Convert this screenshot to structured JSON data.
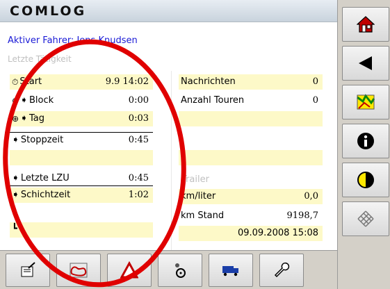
{
  "app": {
    "logo": "COMLOG"
  },
  "header": {
    "driver_text": "Aktiver Fahrer: Jens Knudsen",
    "activity_heading": "Letzte Tätigkeit"
  },
  "left_rows": [
    {
      "label": "Start",
      "value": "9.9 14:02"
    },
    {
      "label": "Block",
      "value": "0:00"
    },
    {
      "label": "Tag",
      "value": "0:03"
    },
    {
      "label": "Stoppzeit",
      "value": "0:45"
    },
    {
      "label": "Letzte LZU",
      "value": "0:45"
    },
    {
      "label": "Schichtzeit",
      "value": "1:02"
    }
  ],
  "right_rows": {
    "messages_label": "Nachrichten",
    "messages_value": "0",
    "tours_label": "Anzahl Touren",
    "tours_value": "0",
    "trailer_label": "Trailer",
    "kml_label": "km/liter",
    "kml_value": "0,0",
    "km_stand_label": "km Stand",
    "km_stand_value": "9198,7",
    "datetime": "09.09.2008 15:08"
  },
  "right_toolbar": [
    {
      "icon": "home-icon"
    },
    {
      "icon": "back-arrow-icon"
    },
    {
      "icon": "map-route-icon"
    },
    {
      "icon": "info-icon"
    },
    {
      "icon": "contrast-icon"
    },
    {
      "icon": "pattern-icon"
    }
  ],
  "bottom_toolbar": [
    {
      "icon": "document-edit-icon"
    },
    {
      "icon": "route-map-icon"
    },
    {
      "icon": "warning-triangle-icon"
    },
    {
      "icon": "driver-steering-icon"
    },
    {
      "icon": "truck-icon"
    },
    {
      "icon": "wrench-icon"
    }
  ],
  "colors": {
    "driver_text": "#1a1ad6",
    "highlight_row": "#fdf9c8",
    "annotation": "#e00000"
  }
}
